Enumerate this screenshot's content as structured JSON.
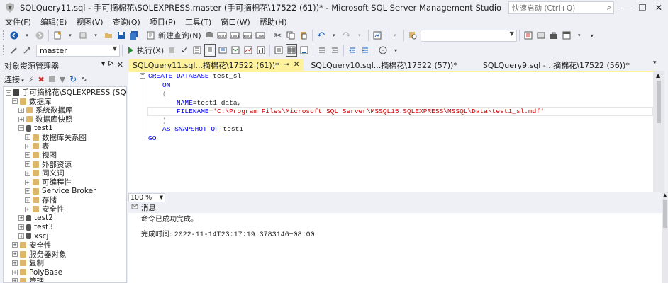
{
  "window": {
    "title": "SQLQuery11.sql - 手可摘棉花\\SQLEXPRESS.master (手可摘棉花\\17522 (61))* - Microsoft SQL Server Management Studio",
    "quick_launch_placeholder": "快速启动 (Ctrl+Q)",
    "minimize": "—",
    "restore": "❐",
    "close": "✕"
  },
  "menu": [
    "文件(F)",
    "编辑(E)",
    "视图(V)",
    "查询(Q)",
    "项目(P)",
    "工具(T)",
    "窗口(W)",
    "帮助(H)"
  ],
  "toolbar1": {
    "new_query_label": "新建查询(N)",
    "search_combo_value": ""
  },
  "toolbar2": {
    "database_combo_value": "master",
    "execute_label": "执行(X)"
  },
  "object_explorer": {
    "title": "对象资源管理器",
    "pin": "ᐅ",
    "close": "✕",
    "connect_label": "连接",
    "tree": [
      {
        "level": 0,
        "expander": "−",
        "icon": "server",
        "label": "手可摘棉花\\SQLEXPRESS (SQL Server"
      },
      {
        "level": 1,
        "expander": "−",
        "icon": "folder",
        "label": "数据库"
      },
      {
        "level": 2,
        "expander": "+",
        "icon": "folder",
        "label": "系统数据库"
      },
      {
        "level": 2,
        "expander": "+",
        "icon": "folder",
        "label": "数据库快照"
      },
      {
        "level": 2,
        "expander": "−",
        "icon": "database",
        "label": "test1"
      },
      {
        "level": 3,
        "expander": "+",
        "icon": "folder",
        "label": "数据库关系图"
      },
      {
        "level": 3,
        "expander": "+",
        "icon": "folder",
        "label": "表"
      },
      {
        "level": 3,
        "expander": "+",
        "icon": "folder",
        "label": "视图"
      },
      {
        "level": 3,
        "expander": "+",
        "icon": "folder",
        "label": "外部资源"
      },
      {
        "level": 3,
        "expander": "+",
        "icon": "folder",
        "label": "同义词"
      },
      {
        "level": 3,
        "expander": "+",
        "icon": "folder",
        "label": "可编程性"
      },
      {
        "level": 3,
        "expander": "+",
        "icon": "folder",
        "label": "Service Broker"
      },
      {
        "level": 3,
        "expander": "+",
        "icon": "folder",
        "label": "存储"
      },
      {
        "level": 3,
        "expander": "+",
        "icon": "folder",
        "label": "安全性"
      },
      {
        "level": 2,
        "expander": "+",
        "icon": "database",
        "label": "test2"
      },
      {
        "level": 2,
        "expander": "+",
        "icon": "database",
        "label": "test3"
      },
      {
        "level": 2,
        "expander": "+",
        "icon": "database",
        "label": "xscj"
      },
      {
        "level": 1,
        "expander": "+",
        "icon": "folder",
        "label": "安全性"
      },
      {
        "level": 1,
        "expander": "+",
        "icon": "folder",
        "label": "服务器对象"
      },
      {
        "level": 1,
        "expander": "+",
        "icon": "folder",
        "label": "复制"
      },
      {
        "level": 1,
        "expander": "+",
        "icon": "folder",
        "label": "PolyBase"
      },
      {
        "level": 1,
        "expander": "+",
        "icon": "folder",
        "label": "管理"
      }
    ]
  },
  "tabs": [
    {
      "label": "SQLQuery11.sql...摘棉花\\17522 (61))*",
      "active": true,
      "pin": "⊸",
      "close": "✕"
    },
    {
      "label": "SQLQuery10.sql...摘棉花\\17522 (57))*",
      "active": false
    },
    {
      "label": "SQLQuery9.sql -...摘棉花\\17522 (56))*",
      "active": false
    }
  ],
  "editor": {
    "line1_kw": "CREATE DATABASE",
    "line1_name": " test_sl",
    "line2": "ON",
    "line3": "(",
    "line4_a": "NAME",
    "line4_b": "=test1_data,",
    "line5_a": "FILENAME",
    "line5_b": "=",
    "line5_str": "'C:\\Program Files\\Microsoft SQL Server\\MSSQL15.SQLEXPRESS\\MSSQL\\Data\\test1_sl.mdf'",
    "line6": ")",
    "line7_kw": "AS SNAPSHOT OF",
    "line7_name": " test1",
    "line8": "GO"
  },
  "zoom": {
    "value": "100 %"
  },
  "results": {
    "tab_label": "消息",
    "line1": "命令已成功完成。",
    "line2_label": "完成时间: ",
    "line2_value": "2022-11-14T23:17:19.3783146+08:00"
  },
  "colors": {
    "active_tab": "#fff29d",
    "keyword": "#0000ff",
    "string": "#cc0000"
  }
}
